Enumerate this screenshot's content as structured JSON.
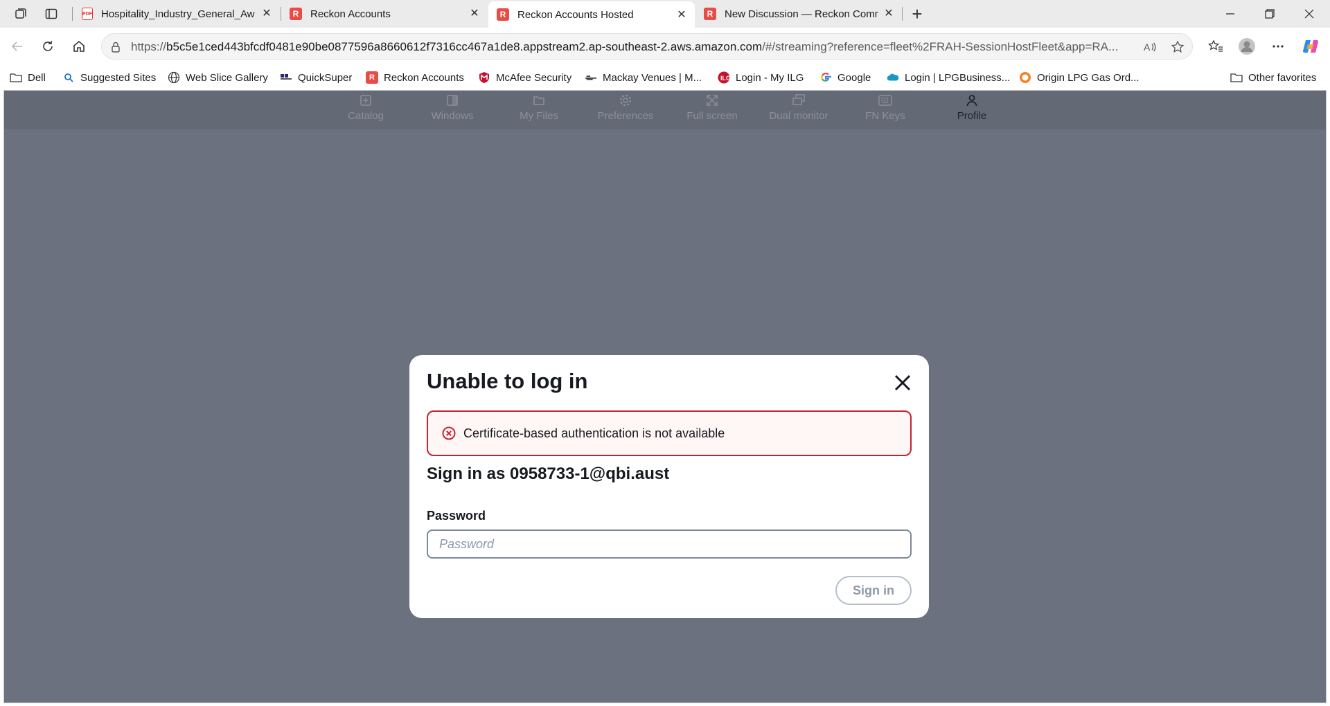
{
  "browser": {
    "tabs": [
      {
        "title": "Hospitality_Industry_General_Awa",
        "favicon": "pdf-icon",
        "active": false
      },
      {
        "title": "Reckon Accounts",
        "favicon": "reckon-r-icon",
        "active": false
      },
      {
        "title": "Reckon Accounts Hosted",
        "favicon": "reckon-r-icon",
        "active": true
      },
      {
        "title": "New Discussion — Reckon Comm",
        "favicon": "reckon-r-icon",
        "active": false
      }
    ],
    "url_prefix": "https://",
    "url_host": "b5c5e1ced443bfcdf0481e90be0877596a8660612f7316cc467a1de8.appstream2.ap-southeast-2.aws.amazon.com",
    "url_rest": "/#/streaming?reference=fleet%2FRAH-SessionHostFleet&app=RA...",
    "favorites": [
      {
        "label": "Dell",
        "icon": "folder-icon"
      },
      {
        "label": "Suggested Sites",
        "icon": "search-icon"
      },
      {
        "label": "Web Slice Gallery",
        "icon": "globe-icon"
      },
      {
        "label": "QuickSuper",
        "icon": "quicksuper-icon"
      },
      {
        "label": "Reckon Accounts",
        "icon": "reckon-r-icon"
      },
      {
        "label": "McAfee Security",
        "icon": "mcafee-icon"
      },
      {
        "label": "Mackay Venues | M...",
        "icon": "mackay-icon"
      },
      {
        "label": "Login - My ILG",
        "icon": "ilg-icon"
      },
      {
        "label": "Google",
        "icon": "google-icon"
      },
      {
        "label": "Login | LPGBusiness...",
        "icon": "salesforce-icon"
      },
      {
        "label": "Origin LPG Gas Ord...",
        "icon": "origin-icon"
      }
    ],
    "other_favorites": "Other favorites"
  },
  "appstream_nav": [
    {
      "label": "Catalog",
      "icon": "catalog-icon",
      "active": false
    },
    {
      "label": "Windows",
      "icon": "windows-icon",
      "active": false
    },
    {
      "label": "My Files",
      "icon": "my-files-icon",
      "active": false
    },
    {
      "label": "Preferences",
      "icon": "preferences-icon",
      "active": false
    },
    {
      "label": "Full screen",
      "icon": "full-screen-icon",
      "active": false
    },
    {
      "label": "Dual monitor",
      "icon": "dual-monitor-icon",
      "active": false
    },
    {
      "label": "FN Keys",
      "icon": "fn-keys-icon",
      "active": false
    },
    {
      "label": "Profile",
      "icon": "profile-icon",
      "active": true
    }
  ],
  "modal": {
    "title": "Unable to log in",
    "error": "Certificate-based authentication is not available",
    "sign_in_as": "Sign in as 0958733-1@qbi.aust",
    "password_label": "Password",
    "password_placeholder": "Password",
    "password_value": "",
    "submit_label": "Sign in"
  },
  "colors": {
    "overlay": "#6b717e",
    "error_border": "#c8202f",
    "reckon_red": "#e94b45"
  }
}
